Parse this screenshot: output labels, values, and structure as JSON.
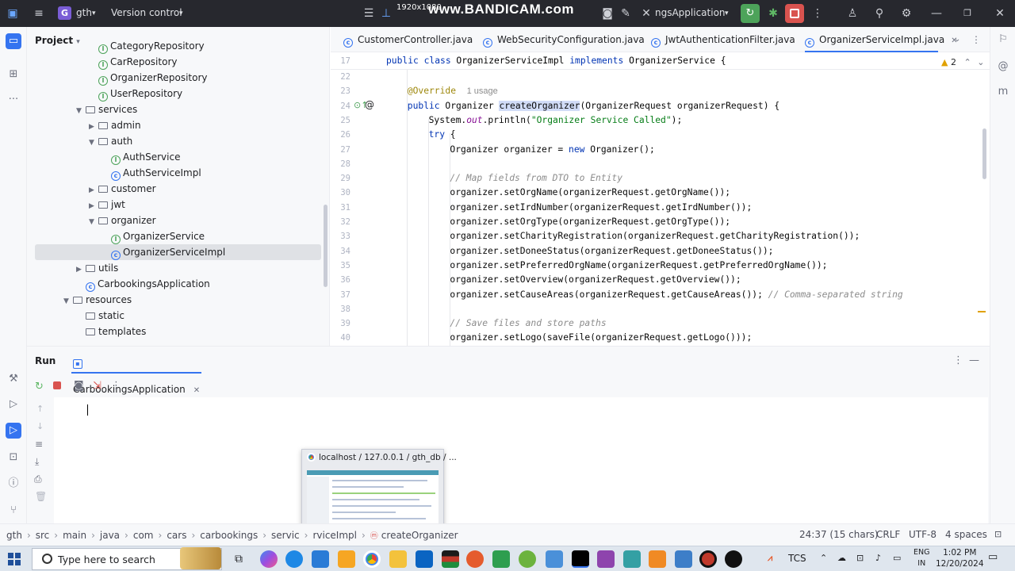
{
  "titlebar": {
    "project_badge": "G",
    "project_name": "gth",
    "vcs": "Version control",
    "recorder_res": "1920x1080",
    "recorder": "www.BANDICAM.com",
    "run_config": "ngsApplication"
  },
  "project_panel": {
    "title": "Project",
    "items": [
      {
        "label": "CategoryRepository",
        "type": "iface",
        "depth": 3
      },
      {
        "label": "CarRepository",
        "type": "iface",
        "depth": 3
      },
      {
        "label": "OrganizerRepository",
        "type": "iface",
        "depth": 3
      },
      {
        "label": "UserRepository",
        "type": "iface",
        "depth": 3
      },
      {
        "label": "services",
        "type": "folder-open",
        "depth": 2
      },
      {
        "label": "admin",
        "type": "folder",
        "depth": 3
      },
      {
        "label": "auth",
        "type": "folder-open",
        "depth": 3
      },
      {
        "label": "AuthService",
        "type": "iface",
        "depth": 4
      },
      {
        "label": "AuthServiceImpl",
        "type": "class",
        "depth": 4
      },
      {
        "label": "customer",
        "type": "folder",
        "depth": 3
      },
      {
        "label": "jwt",
        "type": "folder",
        "depth": 3
      },
      {
        "label": "organizer",
        "type": "folder-open",
        "depth": 3
      },
      {
        "label": "OrganizerService",
        "type": "iface",
        "depth": 4
      },
      {
        "label": "OrganizerServiceImpl",
        "type": "class",
        "depth": 4,
        "selected": true
      },
      {
        "label": "utils",
        "type": "folder",
        "depth": 2
      },
      {
        "label": "CarbookingsApplication",
        "type": "class",
        "depth": 2
      },
      {
        "label": "resources",
        "type": "folder-open",
        "depth": 1
      },
      {
        "label": "static",
        "type": "folder-plain",
        "depth": 2
      },
      {
        "label": "templates",
        "type": "folder-plain",
        "depth": 2
      }
    ]
  },
  "editor_tabs": [
    {
      "label": "CustomerController.java",
      "active": false
    },
    {
      "label": "WebSecurityConfiguration.java",
      "active": false
    },
    {
      "label": "JwtAuthenticationFilter.java",
      "active": false
    },
    {
      "label": "OrganizerServiceImpl.java",
      "active": true
    }
  ],
  "editor": {
    "warnings": "2",
    "sticky": {
      "line": "17",
      "text": "public class OrganizerServiceImpl implements OrganizerService {"
    },
    "usage_hint": "1 usage",
    "lines": [
      {
        "n": "22",
        "code": ""
      },
      {
        "n": "23",
        "code": "@Override"
      },
      {
        "n": "24",
        "code": "public Organizer createOrganizer(OrganizerRequest organizerRequest) {"
      },
      {
        "n": "25",
        "code": "System.out.println(\"Organizer Service Called\");"
      },
      {
        "n": "26",
        "code": "try {"
      },
      {
        "n": "27",
        "code": "Organizer organizer = new Organizer();"
      },
      {
        "n": "28",
        "code": ""
      },
      {
        "n": "29",
        "code": "// Map fields from DTO to Entity"
      },
      {
        "n": "30",
        "code": "organizer.setOrgName(organizerRequest.getOrgName());"
      },
      {
        "n": "31",
        "code": "organizer.setIrdNumber(organizerRequest.getIrdNumber());"
      },
      {
        "n": "32",
        "code": "organizer.setOrgType(organizerRequest.getOrgType());"
      },
      {
        "n": "33",
        "code": "organizer.setCharityRegistration(organizerRequest.getCharityRegistration());"
      },
      {
        "n": "34",
        "code": "organizer.setDoneeStatus(organizerRequest.getDoneeStatus());"
      },
      {
        "n": "35",
        "code": "organizer.setPreferredOrgName(organizerRequest.getPreferredOrgName());"
      },
      {
        "n": "36",
        "code": "organizer.setOverview(organizerRequest.getOverview());"
      },
      {
        "n": "37",
        "code": "organizer.setCauseAreas(organizerRequest.getCauseAreas());"
      },
      {
        "n": "38",
        "code": ""
      },
      {
        "n": "39",
        "code": "// Save files and store paths"
      },
      {
        "n": "40",
        "code": "organizer.setLogo(saveFile(organizerRequest.getLogo()));"
      }
    ],
    "inline_comment_37": "// Comma-separated string"
  },
  "run_panel": {
    "title": "Run",
    "tab": "CarbookingsApplication"
  },
  "thumbnail": {
    "title": "localhost / 127.0.0.1 / gth_db / ..."
  },
  "statusbar": {
    "crumbs": [
      "gth",
      "src",
      "main",
      "java",
      "com",
      "cars",
      "carbookings",
      "servic",
      "rviceImpl",
      "createOrganizer"
    ],
    "position": "24:37 (15 chars)",
    "line_ending": "CRLF",
    "encoding": "UTF-8",
    "indent": "4 spaces"
  },
  "taskbar": {
    "search_placeholder": "Type here to search",
    "tray_label": "TCS",
    "lang_top": "ENG",
    "lang_bottom": "IN",
    "time": "1:02 PM",
    "date": "12/20/2024"
  }
}
